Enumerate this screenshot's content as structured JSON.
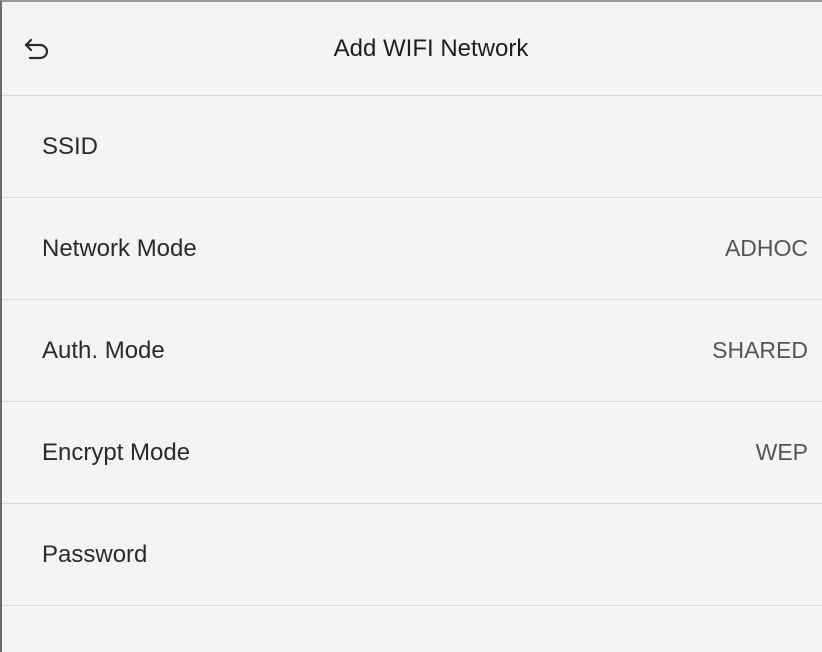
{
  "header": {
    "title": "Add WIFI Network",
    "back_icon": "back-arrow-icon"
  },
  "rows": [
    {
      "label": "SSID",
      "value": ""
    },
    {
      "label": "Network Mode",
      "value": "ADHOC"
    },
    {
      "label": "Auth. Mode",
      "value": "SHARED"
    },
    {
      "label": "Encrypt Mode",
      "value": "WEP"
    },
    {
      "label": "Password",
      "value": ""
    }
  ]
}
